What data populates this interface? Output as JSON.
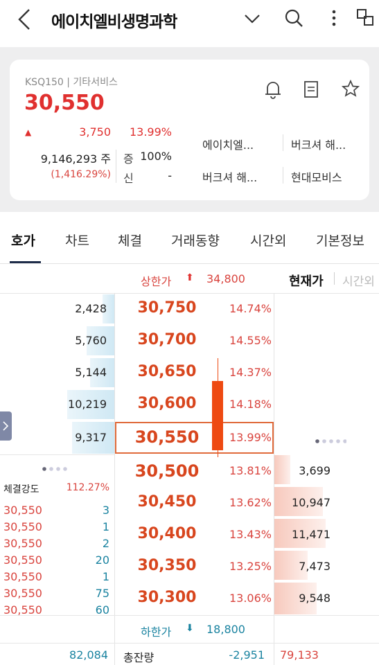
{
  "header": {
    "title": "에이치엘비생명과학"
  },
  "stock": {
    "market": "KSQ150 | 기타서비스",
    "price": "30,550",
    "change_arrow": "▲",
    "change": "3,750",
    "change_pct": "13.99%",
    "volume": "9,146,293 주",
    "volume_ratio": "(1,416.29%)",
    "margin_label": "증",
    "margin_value": "100%",
    "credit_label": "신",
    "credit_value": "-",
    "related": [
      "에이치엘...",
      "버크셔 해...",
      "버크셔 해...",
      "현대모비스"
    ]
  },
  "tabs": [
    "호가",
    "차트",
    "체결",
    "거래동향",
    "시간외",
    "기본정보"
  ],
  "orderbook": {
    "upper_limit_label": "상한가",
    "upper_limit_arrow": "⬆",
    "upper_limit_value": "34,800",
    "current_tab": "현재가",
    "timeout_tab": "시간외",
    "asks": [
      {
        "volume": "2,428",
        "price": "30,750",
        "pct": "14.74%"
      },
      {
        "volume": "5,760",
        "price": "30,700",
        "pct": "14.55%"
      },
      {
        "volume": "5,144",
        "price": "30,650",
        "pct": "14.37%"
      },
      {
        "volume": "10,219",
        "price": "30,600",
        "pct": "14.18%"
      },
      {
        "volume": "9,317",
        "price": "30,550",
        "pct": "13.99%"
      }
    ],
    "bids": [
      {
        "volume": "3,699",
        "price": "30,500",
        "pct": "13.81%"
      },
      {
        "volume": "10,947",
        "price": "30,450",
        "pct": "13.62%"
      },
      {
        "volume": "11,471",
        "price": "30,400",
        "pct": "13.43%"
      },
      {
        "volume": "7,473",
        "price": "30,350",
        "pct": "13.25%"
      },
      {
        "volume": "9,548",
        "price": "30,300",
        "pct": "13.06%"
      }
    ],
    "strength_label": "체결강도",
    "strength_value": "112.27%",
    "trades": [
      {
        "price": "30,550",
        "qty": "3"
      },
      {
        "price": "30,550",
        "qty": "1"
      },
      {
        "price": "30,550",
        "qty": "2"
      },
      {
        "price": "30,550",
        "qty": "20"
      },
      {
        "price": "30,550",
        "qty": "1"
      },
      {
        "price": "30,550",
        "qty": "75"
      },
      {
        "price": "30,550",
        "qty": "60"
      }
    ],
    "lower_limit_label": "하한가",
    "lower_limit_arrow": "⬇",
    "lower_limit_value": "18,800",
    "total_ask": "82,084",
    "total_label": "총잔량",
    "total_diff": "-2,951",
    "total_bid": "79,133"
  },
  "colors": {
    "up": "#e0302f",
    "price": "#d8461e",
    "down": "#1a83a0",
    "ask_bar": "#cfe8f4",
    "bid_bar": "#f7c9bd",
    "candle": "#ee4a12"
  }
}
